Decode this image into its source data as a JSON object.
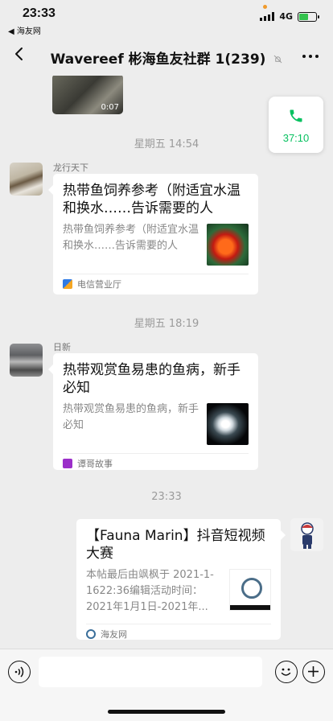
{
  "status_bar": {
    "time": "23:33",
    "back_app": "◀ 海友网",
    "network": "4G"
  },
  "nav": {
    "title": "Wavereef 彬海鱼友社群 1(239)",
    "mute_icon": "mute-bell-icon"
  },
  "call": {
    "duration": "37:10",
    "icon": "phone-icon"
  },
  "messages": {
    "video_duration": "0:07",
    "timestamp_1": "星期五 14:54",
    "sender_1": "龙行天下",
    "card_1": {
      "title": "热带鱼饲养参考（附适宜水温和换水……告诉需要的人",
      "desc": "热带鱼饲养参考（附适宜水温和换水……告诉需要的人",
      "source": "电信营业厅"
    },
    "timestamp_2": "星期五 18:19",
    "sender_2": "日新",
    "card_2": {
      "title": "热带观赏鱼易患的鱼病，新手必知",
      "desc": "热带观赏鱼易患的鱼病，新手必知",
      "source": "谭哥故事"
    },
    "timestamp_3": "23:33",
    "card_3": {
      "title": "【Fauna Marin】抖音短视频大赛",
      "desc": "本帖最后由飒枫于 2021-1-1622:36编辑活动时间：2021年1月1日-2021年...",
      "source": "海友网"
    }
  },
  "input": {
    "placeholder": ""
  },
  "colors": {
    "background": "#ededed",
    "call_green": "#07c160",
    "battery_green": "#33c24d"
  }
}
